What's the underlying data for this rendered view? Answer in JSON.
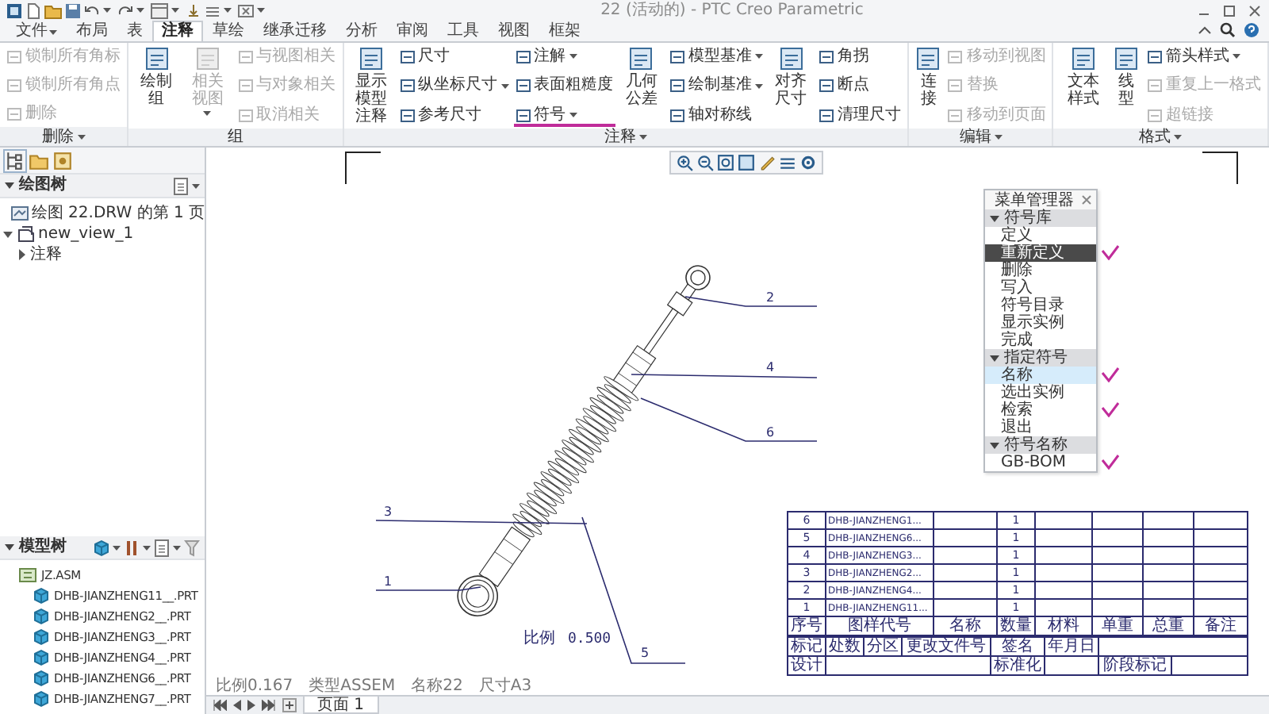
{
  "window": {
    "title": "22 (活动的) - PTC Creo Parametric"
  },
  "ribbon_tabs": [
    {
      "label": "文件",
      "selected": false,
      "dropdown": true
    },
    {
      "label": "布局",
      "selected": false,
      "dropdown": false
    },
    {
      "label": "表",
      "selected": false,
      "dropdown": false
    },
    {
      "label": "注释",
      "selected": true,
      "dropdown": false
    },
    {
      "label": "草绘",
      "selected": false,
      "dropdown": false
    },
    {
      "label": "继承迁移",
      "selected": false,
      "dropdown": false
    },
    {
      "label": "分析",
      "selected": false,
      "dropdown": false
    },
    {
      "label": "审阅",
      "selected": false,
      "dropdown": false
    },
    {
      "label": "工具",
      "selected": false,
      "dropdown": false
    },
    {
      "label": "视图",
      "selected": false,
      "dropdown": false
    },
    {
      "label": "框架",
      "selected": false,
      "dropdown": false
    }
  ],
  "ribbon_groups": [
    {
      "label": "删除",
      "dropdown": true,
      "columns": [
        {
          "kind": "small",
          "items": [
            {
              "label": "锁制所有角标",
              "disabled": true,
              "dropdown": false,
              "marked": false
            },
            {
              "label": "锁制所有角点",
              "disabled": true,
              "dropdown": false,
              "marked": false
            },
            {
              "label": "删除",
              "disabled": true,
              "dropdown": false,
              "marked": false
            }
          ]
        }
      ]
    },
    {
      "label": "组",
      "dropdown": false,
      "columns": [
        {
          "kind": "large",
          "items": [
            {
              "label": "绘制组",
              "disabled": false,
              "dropdown": false,
              "marked": false
            }
          ]
        },
        {
          "kind": "large",
          "items": [
            {
              "label": "相关视图",
              "disabled": true,
              "dropdown": true,
              "marked": false
            }
          ]
        },
        {
          "kind": "small",
          "items": [
            {
              "label": "与视图相关",
              "disabled": true,
              "dropdown": false,
              "marked": false
            },
            {
              "label": "与对象相关",
              "disabled": true,
              "dropdown": false,
              "marked": false
            },
            {
              "label": "取消相关",
              "disabled": true,
              "dropdown": false,
              "marked": false
            }
          ]
        }
      ]
    },
    {
      "label": "注释",
      "dropdown": true,
      "columns": [
        {
          "kind": "large",
          "items": [
            {
              "label": "显示模型注释",
              "disabled": false,
              "dropdown": false,
              "marked": false
            }
          ]
        },
        {
          "kind": "small",
          "items": [
            {
              "label": "尺寸",
              "disabled": false,
              "dropdown": false,
              "marked": false
            },
            {
              "label": "纵坐标尺寸",
              "disabled": false,
              "dropdown": true,
              "marked": false
            },
            {
              "label": "参考尺寸",
              "disabled": false,
              "dropdown": false,
              "marked": false
            }
          ]
        },
        {
          "kind": "small",
          "items": [
            {
              "label": "注解",
              "disabled": false,
              "dropdown": true,
              "marked": false
            },
            {
              "label": "表面粗糙度",
              "disabled": false,
              "dropdown": false,
              "marked": false
            },
            {
              "label": "符号",
              "disabled": false,
              "dropdown": true,
              "marked": true
            }
          ]
        },
        {
          "kind": "large",
          "items": [
            {
              "label": "几何公差",
              "disabled": false,
              "dropdown": false,
              "marked": false
            }
          ]
        },
        {
          "kind": "small",
          "items": [
            {
              "label": "模型基准",
              "disabled": false,
              "dropdown": true,
              "marked": false
            },
            {
              "label": "绘制基准",
              "disabled": false,
              "dropdown": true,
              "marked": false
            },
            {
              "label": "轴对称线",
              "disabled": false,
              "dropdown": false,
              "marked": false
            }
          ]
        },
        {
          "kind": "large",
          "items": [
            {
              "label": "对齐尺寸",
              "disabled": false,
              "dropdown": false,
              "marked": false
            }
          ]
        },
        {
          "kind": "small",
          "items": [
            {
              "label": "角拐",
              "disabled": false,
              "dropdown": false,
              "marked": false
            },
            {
              "label": "断点",
              "disabled": false,
              "dropdown": false,
              "marked": false
            },
            {
              "label": "清理尺寸",
              "disabled": false,
              "dropdown": false,
              "marked": false
            }
          ]
        }
      ]
    },
    {
      "label": "编辑",
      "dropdown": true,
      "columns": [
        {
          "kind": "large",
          "items": [
            {
              "label": "连接",
              "disabled": false,
              "dropdown": false,
              "marked": false
            }
          ]
        },
        {
          "kind": "small",
          "items": [
            {
              "label": "移动到视图",
              "disabled": true,
              "dropdown": false,
              "marked": false
            },
            {
              "label": "替换",
              "disabled": true,
              "dropdown": false,
              "marked": false
            },
            {
              "label": "移动到页面",
              "disabled": true,
              "dropdown": false,
              "marked": false
            }
          ]
        }
      ]
    },
    {
      "label": "格式",
      "dropdown": true,
      "columns": [
        {
          "kind": "large",
          "items": [
            {
              "label": "文本样式",
              "disabled": false,
              "dropdown": false,
              "marked": false
            }
          ]
        },
        {
          "kind": "large",
          "items": [
            {
              "label": "线型",
              "disabled": false,
              "dropdown": false,
              "marked": false
            }
          ]
        },
        {
          "kind": "small",
          "items": [
            {
              "label": "箭头样式",
              "disabled": false,
              "dropdown": true,
              "marked": false
            },
            {
              "label": "重复上一格式",
              "disabled": true,
              "dropdown": false,
              "marked": false
            },
            {
              "label": "超链接",
              "disabled": true,
              "dropdown": false,
              "marked": false
            }
          ]
        }
      ]
    }
  ],
  "left_panel": {
    "drawing_tree": {
      "title": "绘图树",
      "items": [
        {
          "label": "绘图 22.DRW 的第 1 页",
          "kind": "sheet"
        },
        {
          "label": "new_view_1",
          "kind": "view",
          "expanded": true,
          "children": [
            {
              "label": "注释",
              "expanded": false
            }
          ]
        }
      ]
    },
    "model_tree": {
      "title": "模型树",
      "items": [
        {
          "label": "JZ.ASM",
          "kind": "assembly",
          "children": [
            {
              "label": "DHB-JIANZHENG11__.PRT",
              "kind": "part"
            },
            {
              "label": "DHB-JIANZHENG2__.PRT",
              "kind": "part"
            },
            {
              "label": "DHB-JIANZHENG3__.PRT",
              "kind": "part"
            },
            {
              "label": "DHB-JIANZHENG4__.PRT",
              "kind": "part"
            },
            {
              "label": "DHB-JIANZHENG6__.PRT",
              "kind": "part"
            },
            {
              "label": "DHB-JIANZHENG7__.PRT",
              "kind": "part"
            }
          ]
        }
      ]
    }
  },
  "balloons": [
    {
      "number": "2"
    },
    {
      "number": "4"
    },
    {
      "number": "6"
    },
    {
      "number": "3"
    },
    {
      "number": "1"
    },
    {
      "number": "5"
    }
  ],
  "scale_note": {
    "label": "比例",
    "value": "0.500"
  },
  "menu_manager": {
    "title": "菜单管理器",
    "sections": [
      {
        "title": "符号库",
        "items": [
          {
            "label": "定义",
            "selected": false,
            "hovered": false,
            "marked": false
          },
          {
            "label": "重新定义",
            "selected": true,
            "hovered": false,
            "marked": true
          },
          {
            "label": "删除",
            "selected": false,
            "hovered": false,
            "marked": false
          },
          {
            "label": "写入",
            "selected": false,
            "hovered": false,
            "marked": false
          },
          {
            "label": "符号目录",
            "selected": false,
            "hovered": false,
            "marked": false
          },
          {
            "label": "显示实例",
            "selected": false,
            "hovered": false,
            "marked": false
          },
          {
            "label": "完成",
            "selected": false,
            "hovered": false,
            "marked": false
          }
        ]
      },
      {
        "title": "指定符号",
        "items": [
          {
            "label": "名称",
            "selected": false,
            "hovered": true,
            "marked": true
          },
          {
            "label": "选出实例",
            "selected": false,
            "hovered": false,
            "marked": false
          },
          {
            "label": "检索",
            "selected": false,
            "hovered": false,
            "marked": true
          },
          {
            "label": "退出",
            "selected": false,
            "hovered": false,
            "marked": false
          }
        ]
      },
      {
        "title": "符号名称",
        "items": [
          {
            "label": "GB-BOM",
            "selected": false,
            "hovered": false,
            "marked": true
          }
        ]
      }
    ]
  },
  "bom_table": {
    "columns": [
      "序号",
      "图样代号",
      "名称",
      "数量",
      "材料",
      "单重",
      "总重",
      "备注"
    ],
    "rows": [
      {
        "index": "6",
        "code": "DHB-JIANZHENG1...",
        "quantity": "1"
      },
      {
        "index": "5",
        "code": "DHB-JIANZHENG6...",
        "quantity": "1"
      },
      {
        "index": "4",
        "code": "DHB-JIANZHENG3...",
        "quantity": "1"
      },
      {
        "index": "3",
        "code": "DHB-JIANZHENG2...",
        "quantity": "1"
      },
      {
        "index": "2",
        "code": "DHB-JIANZHENG4...",
        "quantity": "1"
      },
      {
        "index": "1",
        "code": "DHB-JIANZHENG11...",
        "quantity": "1"
      }
    ]
  },
  "title_block": {
    "header": [
      "标记",
      "处数",
      "分区",
      "更改文件号",
      "签名",
      "年月日"
    ],
    "rows": [
      {
        "left": "设计",
        "right": "标准化"
      }
    ],
    "stage_label": "阶段标记"
  },
  "status_bar": [
    "比例0.167",
    "类型ASSEM",
    "名称22",
    "尺寸A3"
  ],
  "page_tabs": [
    {
      "label": "页面 1",
      "selected": true
    }
  ]
}
